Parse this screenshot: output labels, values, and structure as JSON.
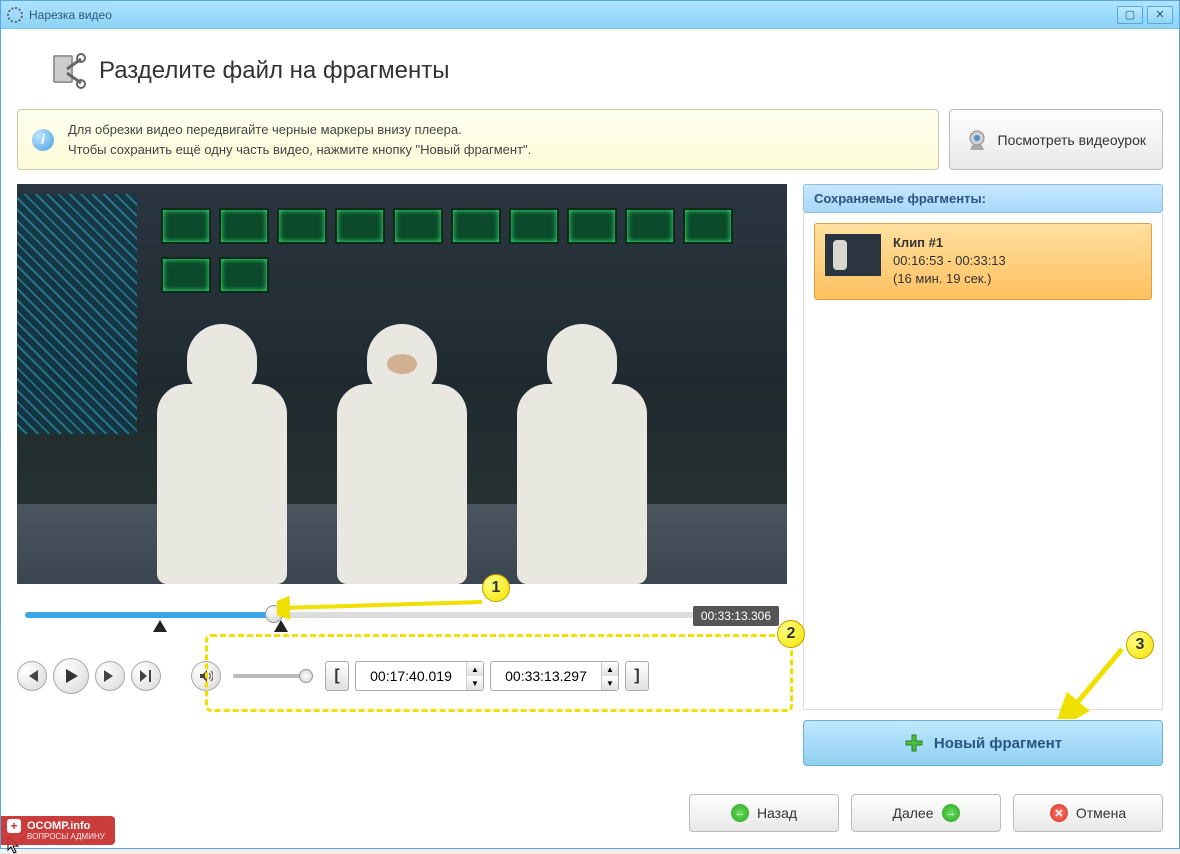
{
  "window": {
    "title": "Нарезка видео"
  },
  "header": {
    "title": "Разделите файл на фрагменты"
  },
  "info": {
    "line1": "Для обрезки видео передвигайте черные маркеры внизу плеера.",
    "line2": "Чтобы сохранить ещё одну часть видео, нажмите кнопку \"Новый фрагмент\"."
  },
  "tutorial_btn": "Посмотреть видеоурок",
  "timeline": {
    "current_time": "00:33:13.306",
    "start_time": "00:17:40.019",
    "end_time": "00:33:13.297"
  },
  "side": {
    "header": "Сохраняемые фрагменты:",
    "fragments": [
      {
        "name": "Клип #1",
        "range": "00:16:53 - 00:33:13",
        "duration": "(16 мин. 19 сек.)"
      }
    ],
    "new_fragment_btn": "Новый фрагмент"
  },
  "callouts": {
    "c1": "1",
    "c2": "2",
    "c3": "3"
  },
  "footer": {
    "back": "Назад",
    "next": "Далее",
    "cancel": "Отмена"
  },
  "watermark": {
    "main": "OCOMP.info",
    "sub": "ВОПРОСЫ АДМИНУ"
  }
}
